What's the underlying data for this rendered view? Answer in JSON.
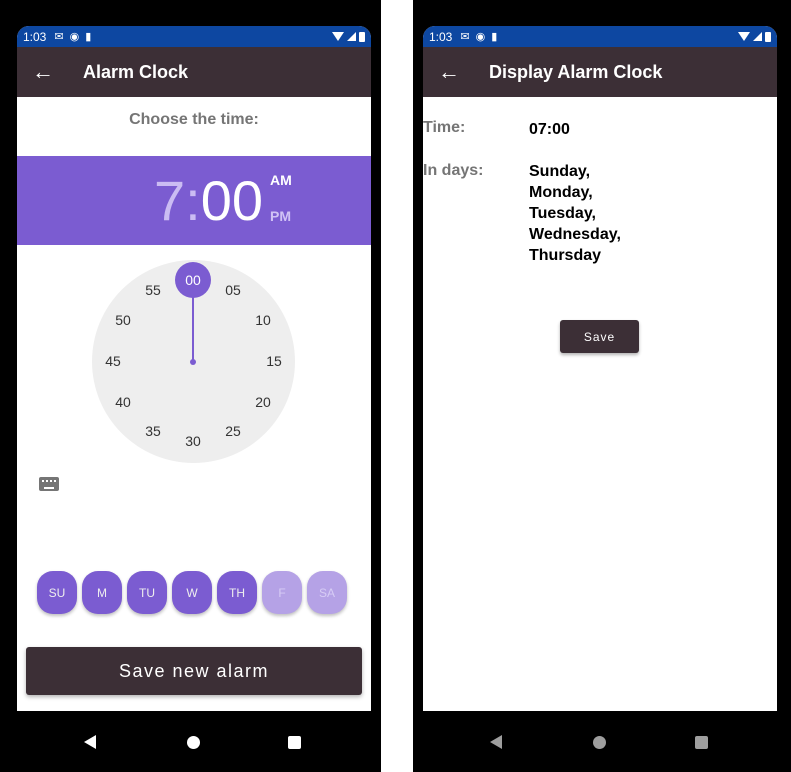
{
  "left_screen": {
    "status": {
      "time": "1:03"
    },
    "app_bar": {
      "title": "Alarm Clock"
    },
    "choose_label": "Choose the time:",
    "time_picker": {
      "hour": "7",
      "separator": ":",
      "minute": "00",
      "am": "AM",
      "pm": "PM",
      "selected_period": "AM"
    },
    "clock": {
      "selected": "00",
      "numbers": [
        "05",
        "10",
        "15",
        "20",
        "25",
        "30",
        "35",
        "40",
        "45",
        "50",
        "55"
      ]
    },
    "days": [
      {
        "label": "SU",
        "selected": true
      },
      {
        "label": "M",
        "selected": true
      },
      {
        "label": "TU",
        "selected": true
      },
      {
        "label": "W",
        "selected": true
      },
      {
        "label": "TH",
        "selected": true
      },
      {
        "label": "F",
        "selected": false
      },
      {
        "label": "SA",
        "selected": false
      }
    ],
    "save_button": "Save new alarm",
    "icons": [
      "back-arrow-icon",
      "keyboard-icon"
    ]
  },
  "right_screen": {
    "status": {
      "time": "1:03"
    },
    "app_bar": {
      "title": "Display Alarm Clock"
    },
    "time_label": "Time:",
    "time_value": "07:00",
    "days_label": "In days:",
    "days_values": [
      "Sunday,",
      "Monday,",
      "Tuesday,",
      "Wednesday,",
      "Thursday"
    ],
    "save_button": "Save"
  },
  "colors": {
    "status_bar": "#0d47a1",
    "app_bar": "#3c2f36",
    "accent": "#7b5cd1",
    "accent_light": "#b5a2e6"
  }
}
